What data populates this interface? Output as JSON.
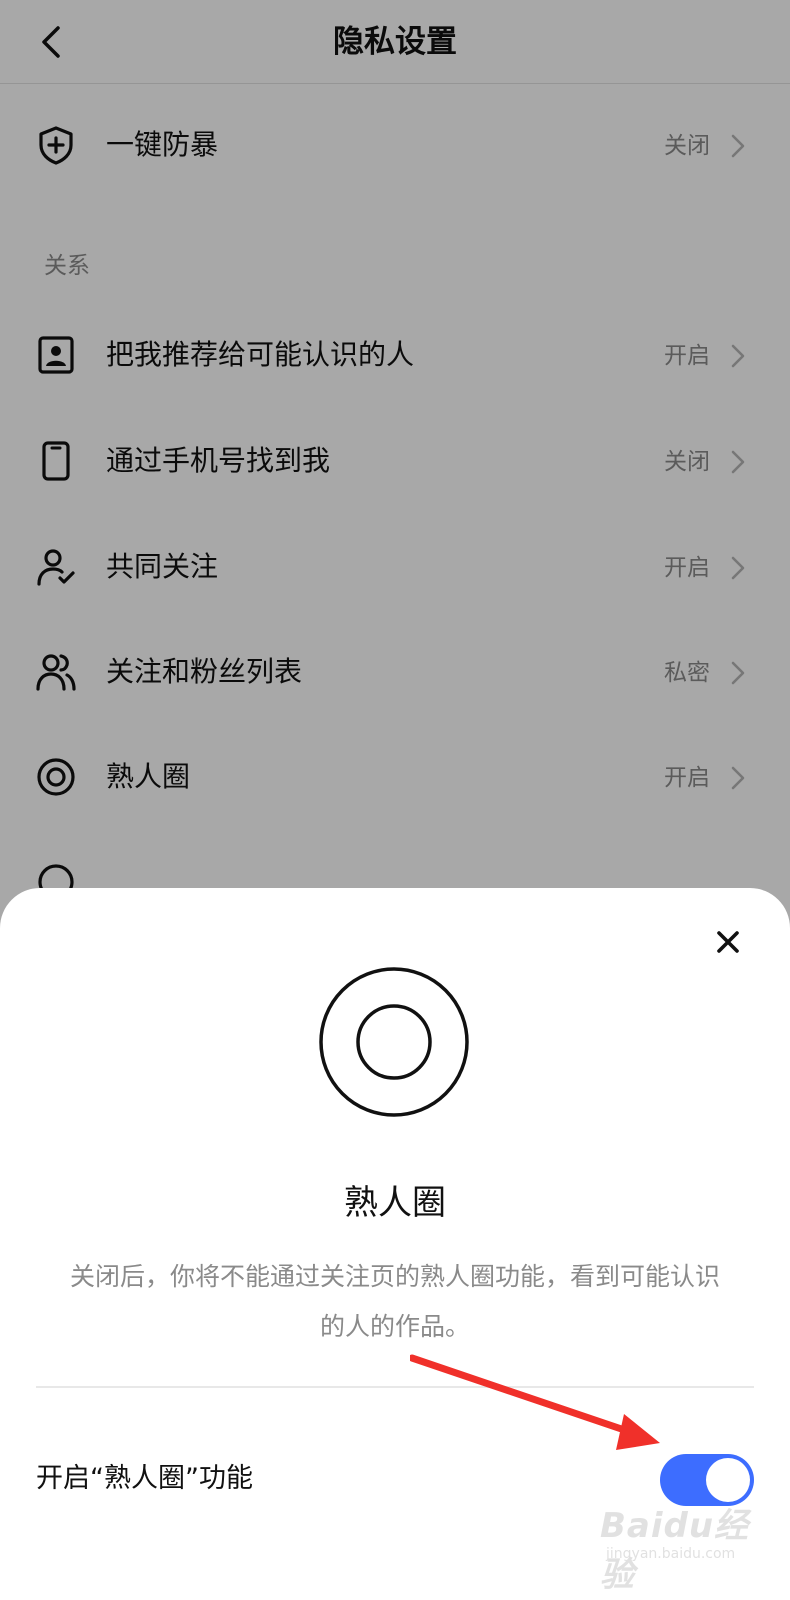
{
  "header": {
    "title": "隐私设置"
  },
  "top_item": {
    "label": "一键防暴",
    "value": "关闭",
    "icon": "shield-plus-icon"
  },
  "section": {
    "title": "关系"
  },
  "items": [
    {
      "label": "把我推荐给可能认识的人",
      "value": "开启",
      "icon": "contact-card-icon"
    },
    {
      "label": "通过手机号找到我",
      "value": "关闭",
      "icon": "phone-icon"
    },
    {
      "label": "共同关注",
      "value": "开启",
      "icon": "user-check-icon"
    },
    {
      "label": "关注和粉丝列表",
      "value": "私密",
      "icon": "users-icon"
    },
    {
      "label": "熟人圈",
      "value": "开启",
      "icon": "circle-target-icon"
    }
  ],
  "sheet": {
    "title": "熟人圈",
    "description": "关闭后，你将不能通过关注页的熟人圈功能，看到可能认识的人的作品。",
    "toggle_label": "开启“熟人圈”功能",
    "toggle_on": true
  },
  "colors": {
    "accent": "#3d6dff",
    "arrow": "#f0302a"
  },
  "watermark": {
    "main": "Baidu经验",
    "sub": "jingyan.baidu.com"
  }
}
